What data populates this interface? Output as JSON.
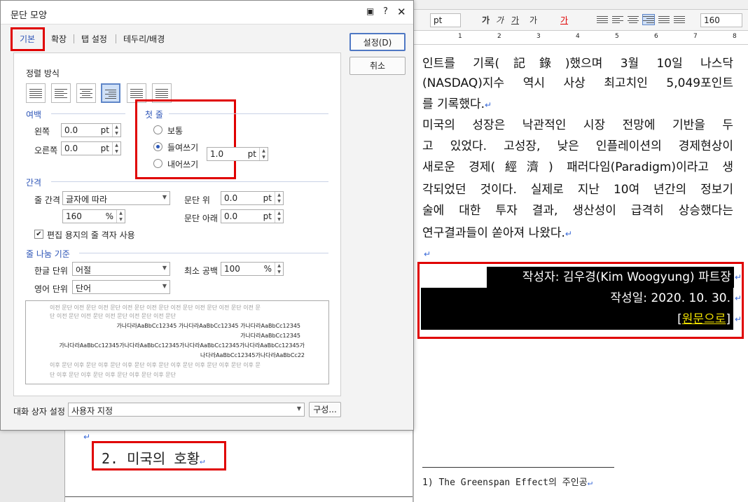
{
  "toolbar": {
    "unit": "pt",
    "font_size": "160",
    "style_buttons": [
      "가",
      "가",
      "가",
      "가",
      "가"
    ]
  },
  "ruler": {
    "mark_1": "1",
    "mark_2": "2",
    "mark_3": "3",
    "mark_4": "4",
    "mark_5": "5",
    "mark_6": "6",
    "mark_7": "7",
    "mark_8": "8"
  },
  "document": {
    "lines": [
      "인트를 기록(記錄)했으며 3월 10일 나스닥",
      "(NASDAQ)지수 역시 사상 최고치인 5,049포인트",
      "를 기록했다.",
      "  미국의 성장은 낙관적인 시장 전망에 기반을 두",
      "고 있었다. 고성장, 낮은 인플레이션의 경제현상이",
      "새로운 경제(經濟) 패러다임(Paradigm)이라고 생",
      "각되었던 것이다. 실제로 지난 10여 년간의 정보기",
      "술에 대한 투자 결과, 생산성이 급격히 상승했다는",
      "연구결과들이 쏟아져 나왔다."
    ],
    "return_mark": "↵",
    "author": "작성자: 김우경(Kim Woogyung) 파트장",
    "date": "작성일: 2020. 10. 30.",
    "link_open": "[",
    "link_text": "원문으로",
    "link_close": "]",
    "heading": "2. 미국의 호황",
    "footnote": "1) The Greenspan Effect의 주인공"
  },
  "dialog": {
    "title": "문단 모양",
    "tabs": [
      "기본",
      "확장",
      "탭 설정",
      "테두리/배경"
    ],
    "buttons": {
      "ok": "설정(D)",
      "cancel": "취소",
      "compose": "구성..."
    },
    "align_label": "정렬 방식",
    "margin": {
      "label": "여백",
      "left_label": "왼쪽",
      "left_value": "0.0",
      "right_label": "오른쪽",
      "right_value": "0.0",
      "unit": "pt"
    },
    "first_line": {
      "label": "첫 줄",
      "options": [
        "보통",
        "들여쓰기",
        "내어쓰기"
      ],
      "selected": "들여쓰기",
      "value": "1.0",
      "unit": "pt"
    },
    "spacing": {
      "label": "간격",
      "line_label": "줄 간격",
      "line_type": "글자에 따라",
      "line_value": "160",
      "line_unit": "%",
      "above_label": "문단 위",
      "above_value": "0.0",
      "below_label": "문단 아래",
      "below_value": "0.0",
      "unit": "pt",
      "grid_checkbox": "편집 용지의 줄 격자 사용",
      "grid_checked": true
    },
    "linebreak": {
      "label": "줄 나눔 기준",
      "korean_label": "한글 단위",
      "korean_value": "어절",
      "english_label": "영어 단위",
      "english_value": "단어",
      "min_space_label": "최소 공백",
      "min_space_value": "100",
      "min_space_unit": "%"
    },
    "preview": {
      "prev_1": "이전 문단 이전 문단 이전 문단 이전 문단 이전 문단 이전 문단 이전 문단 이전 문단 이전 문",
      "prev_2": "단 이전 문단 이전 문단 이전 문단 이전 문단 이전 문단",
      "cur_1": "가나다라AaBbCc12345 가나다라AaBbCc12345 가나다라AaBbCc12345",
      "cur_2": "가나다라AaBbCc12345",
      "cur_3": "가나다라AaBbCc12345가나다라AaBbCc12345가나다라AaBbCc12345가나다라AaBbCc12345가",
      "cur_4": "나다라AaBbCc12345가나다라AaBbCc22",
      "next_1": "이후 문단 이후 문단 이후 문단 이후 문단 이후 문단 이후 문단 이후 문단 이후 문단 이후 문",
      "next_2": "단 이후 문단 이후 문단 이후 문단 이후 문단 이후 문단"
    },
    "dialog_setting_label": "대화 상자 설정",
    "dialog_setting_value": "사용자 지정"
  },
  "colors": {
    "highlight_red": "#e00000",
    "link_yellow": "#f0e000",
    "section_blue": "#2d55b7"
  }
}
